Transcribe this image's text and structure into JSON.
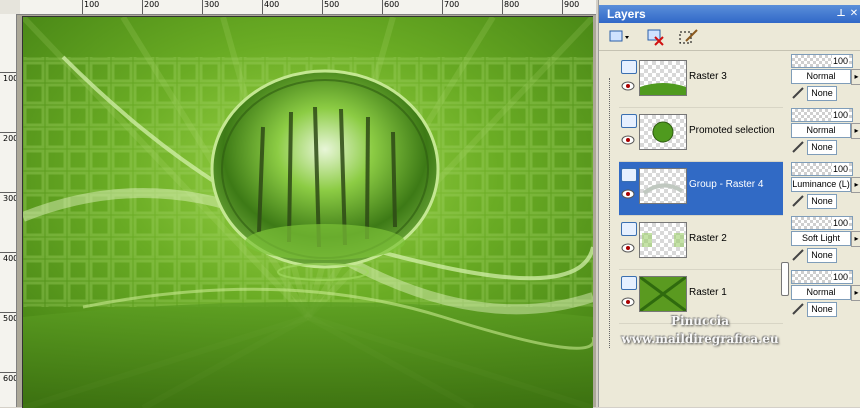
{
  "ruler": {
    "top_labels": [
      "100",
      "200",
      "300",
      "400",
      "500",
      "600",
      "700",
      "800",
      "900"
    ],
    "left_labels": [
      "100",
      "200",
      "300",
      "400",
      "500",
      "600"
    ]
  },
  "palette": {
    "title": "Layers",
    "pin_glyph": "⊥",
    "close_glyph": "✕"
  },
  "layers": [
    {
      "name": "Raster 3",
      "opacity": "100",
      "blend": "Normal",
      "mask": "None",
      "selected": false
    },
    {
      "name": "Promoted selection",
      "opacity": "100",
      "blend": "Normal",
      "mask": "None",
      "selected": false
    },
    {
      "name": "Group - Raster 4",
      "opacity": "100",
      "blend": "Luminance (L)",
      "mask": "None",
      "selected": true
    },
    {
      "name": "Raster 2",
      "opacity": "100",
      "blend": "Soft Light",
      "mask": "None",
      "selected": false
    },
    {
      "name": "Raster 1",
      "opacity": "100",
      "blend": "Normal",
      "mask": "None",
      "selected": false
    }
  ],
  "watermark": {
    "line1": "Pinuccia",
    "line2": "www.maildiregrafica.eu"
  },
  "colors": {
    "selection": "#316ac5",
    "canvas_green": "#5a9a20",
    "titlebar": "#3168c8"
  },
  "icons": {
    "new_layer": "new-layer-icon",
    "delete_layer": "delete-layer-icon",
    "edit_selection": "edit-selection-icon",
    "visibility": "eye-icon",
    "mask": "brush-icon"
  }
}
